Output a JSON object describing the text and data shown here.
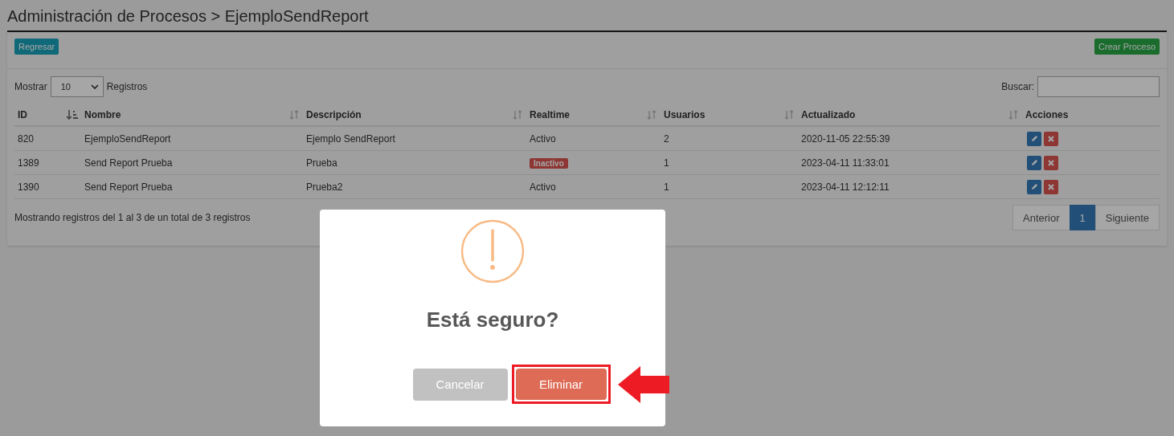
{
  "page_title": "Administración de Procesos > EjemploSendReport",
  "toolbar": {
    "back_button": "Regresar",
    "create_button": "Crear Proceso"
  },
  "length_control": {
    "prefix": "Mostrar",
    "value": "10",
    "suffix": "Registros"
  },
  "search": {
    "label": "Buscar:"
  },
  "table": {
    "columns": [
      {
        "label": "ID",
        "sortable": true,
        "sorted": true
      },
      {
        "label": "Nombre",
        "sortable": true,
        "sorted": false
      },
      {
        "label": "Descripción",
        "sortable": true,
        "sorted": false
      },
      {
        "label": "Realtime",
        "sortable": true,
        "sorted": false
      },
      {
        "label": "Usuarios",
        "sortable": true,
        "sorted": false
      },
      {
        "label": "Actualizado",
        "sortable": true,
        "sorted": false
      },
      {
        "label": "Acciones",
        "sortable": false
      }
    ],
    "rows": [
      {
        "id": "820",
        "name": "EjemploSendReport",
        "description": "Ejemplo SendReport",
        "realtime": {
          "text": "Activo",
          "kind": "plain"
        },
        "users": "2",
        "updated": "2020-11-05 22:55:39"
      },
      {
        "id": "1389",
        "name": "Send Report Prueba",
        "description": "Prueba",
        "realtime": {
          "text": "Inactivo",
          "kind": "badge"
        },
        "users": "1",
        "updated": "2023-04-11 11:33:01"
      },
      {
        "id": "1390",
        "name": "Send Report Prueba",
        "description": "Prueba2",
        "realtime": {
          "text": "Activo",
          "kind": "plain"
        },
        "users": "1",
        "updated": "2023-04-11 12:12:11"
      }
    ]
  },
  "info": "Mostrando registros del 1 al 3 de un total de 3 registros",
  "pagination": [
    {
      "label": "Anterior",
      "selected": false
    },
    {
      "label": "1",
      "selected": true
    },
    {
      "label": "Siguiente",
      "selected": false
    }
  ],
  "dialog": {
    "title": "Está seguro?",
    "cancel_button": "Cancelar",
    "confirm_button": "Eliminar",
    "confirm_highlighted": true
  }
}
